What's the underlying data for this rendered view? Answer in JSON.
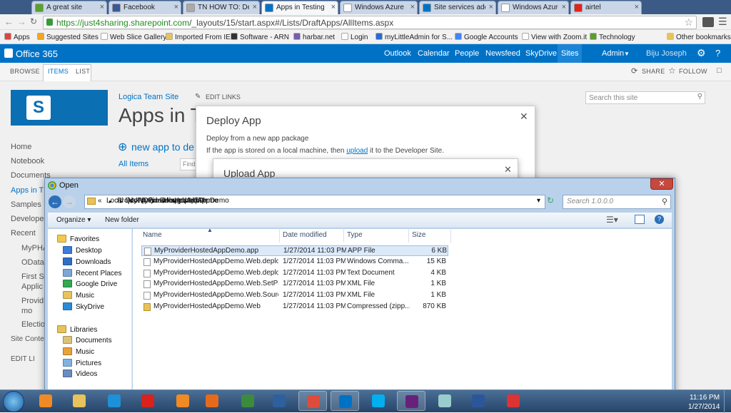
{
  "browser": {
    "tabs": [
      {
        "label": "A great site",
        "color": "#5aa02c"
      },
      {
        "label": "Facebook",
        "color": "#3b5998"
      },
      {
        "label": "TN HOW TO: Deploy",
        "color": "#aaaaaa"
      },
      {
        "label": "Apps in Testing",
        "color": "#0072c6",
        "active": true
      },
      {
        "label": "Windows Azure",
        "color": "#ffffff"
      },
      {
        "label": "Site services add",
        "color": "#0072c6"
      },
      {
        "label": "Windows Azure",
        "color": "#ffffff"
      },
      {
        "label": "airtel",
        "color": "#e2231a"
      }
    ],
    "url_host": "https://just4sharing.sharepoint.com",
    "url_path": "/_layouts/15/start.aspx#/Lists/DraftApps/AllItems.aspx",
    "bookmarks": [
      {
        "label": "Apps",
        "color": "#d44"
      },
      {
        "label": "Suggested Sites",
        "color": "#f5a623"
      },
      {
        "label": "Web Slice Gallery",
        "color": "#ffffff"
      },
      {
        "label": "Imported From IE",
        "color": "#e8c25a"
      },
      {
        "label": "Software - ARN",
        "color": "#333333"
      },
      {
        "label": "harbar.net",
        "color": "#7a5cb0"
      },
      {
        "label": "Login",
        "color": "#ffffff"
      },
      {
        "label": "myLittleAdmin for S...",
        "color": "#2a6bd1"
      },
      {
        "label": "Google Accounts",
        "color": "#4285f4"
      },
      {
        "label": "View with Zoom.it",
        "color": "#ffffff"
      },
      {
        "label": "Technology",
        "color": "#5aa02c"
      }
    ],
    "other_bookmarks": "Other bookmarks"
  },
  "o365": {
    "brand": "Office 365",
    "nav": [
      "Outlook",
      "Calendar",
      "People",
      "Newsfeed",
      "SkyDrive",
      "Sites"
    ],
    "admin": "Admin",
    "user": "Biju Joseph"
  },
  "ribbon": {
    "tabs": [
      "BROWSE",
      "ITEMS",
      "LIST"
    ],
    "share": "SHARE",
    "follow": "FOLLOW"
  },
  "sp": {
    "site_link": "Logica Team Site",
    "edit_links": "EDIT LINKS",
    "title": "Apps in Te",
    "search_placeholder": "Search this site",
    "new_app": "new app to de",
    "all_items": "All Items",
    "find": "Find",
    "leftnav": [
      "Home",
      "Notebook",
      "Documents",
      "Apps in T",
      "Samples",
      "Developer",
      "Recent",
      "MyPHA",
      "OData",
      "First SP",
      "Applic",
      "Provid",
      "mo",
      "Electio",
      "Site Conte",
      "EDIT LI"
    ]
  },
  "deploy_dialog": {
    "title": "Deploy App",
    "line1": "Deploy from a new app package",
    "line2_pre": "If the app is stored on a local machine, then ",
    "line2_link": "upload",
    "line2_post": " it to the Developer Site."
  },
  "upload_dialog": {
    "title": "Upload App"
  },
  "open_dialog": {
    "title": "Open",
    "path": [
      "Local Disk (D:)",
      "Project",
      "MyProviderHostedAppDemo",
      "MyProviderHostedAppDemo",
      "bin",
      "Debug",
      "app.publish",
      "1.0.0.0"
    ],
    "search_placeholder": "Search 1.0.0.0",
    "organize": "Organize",
    "new_folder": "New folder",
    "columns": [
      "Name",
      "Date modified",
      "Type",
      "Size"
    ],
    "favorites_header": "Favorites",
    "favorites": [
      "Desktop",
      "Downloads",
      "Recent Places",
      "Google Drive",
      "Music",
      "SkyDrive"
    ],
    "libraries_header": "Libraries",
    "libraries": [
      "Documents",
      "Music",
      "Pictures",
      "Videos"
    ],
    "files": [
      {
        "name": "MyProviderHostedAppDemo.app",
        "date": "1/27/2014 11:03 PM",
        "type": "APP File",
        "size": "6 KB",
        "selected": true
      },
      {
        "name": "MyProviderHostedAppDemo.Web.deploy",
        "date": "1/27/2014 11:03 PM",
        "type": "Windows Comma...",
        "size": "15 KB"
      },
      {
        "name": "MyProviderHostedAppDemo.Web.deplo...",
        "date": "1/27/2014 11:03 PM",
        "type": "Text Document",
        "size": "4 KB"
      },
      {
        "name": "MyProviderHostedAppDemo.Web.SetPar...",
        "date": "1/27/2014 11:03 PM",
        "type": "XML File",
        "size": "1 KB"
      },
      {
        "name": "MyProviderHostedAppDemo.Web.Sourc...",
        "date": "1/27/2014 11:03 PM",
        "type": "XML File",
        "size": "1 KB"
      },
      {
        "name": "MyProviderHostedAppDemo.Web",
        "date": "1/27/2014 11:03 PM",
        "type": "Compressed (zipp...",
        "size": "870 KB"
      }
    ]
  },
  "taskbar": {
    "apps": [
      {
        "name": "media-player-icon",
        "color": "#f08a24"
      },
      {
        "name": "file-explorer-icon",
        "color": "#e8c25a"
      },
      {
        "name": "internet-explorer-icon",
        "color": "#1e90d8"
      },
      {
        "name": "opera-icon",
        "color": "#d8221b"
      },
      {
        "name": "vlc-icon",
        "color": "#f08a24"
      },
      {
        "name": "firefox-icon",
        "color": "#e66a1c"
      },
      {
        "name": "project-icon",
        "color": "#3c8b3c"
      },
      {
        "name": "virtualbox-icon",
        "color": "#2e5f9e"
      },
      {
        "name": "chrome-icon",
        "color": "#dd4b39"
      },
      {
        "name": "outlook-icon",
        "color": "#0072c6"
      },
      {
        "name": "skype-icon",
        "color": "#00aff0"
      },
      {
        "name": "visual-studio-icon",
        "color": "#68217a"
      },
      {
        "name": "azure-tool-icon",
        "color": "#9cc"
      },
      {
        "name": "word-icon",
        "color": "#2b579a"
      },
      {
        "name": "snipping-tool-icon",
        "color": "#d33"
      }
    ],
    "time": "11:16 PM",
    "date": "1/27/2014"
  }
}
